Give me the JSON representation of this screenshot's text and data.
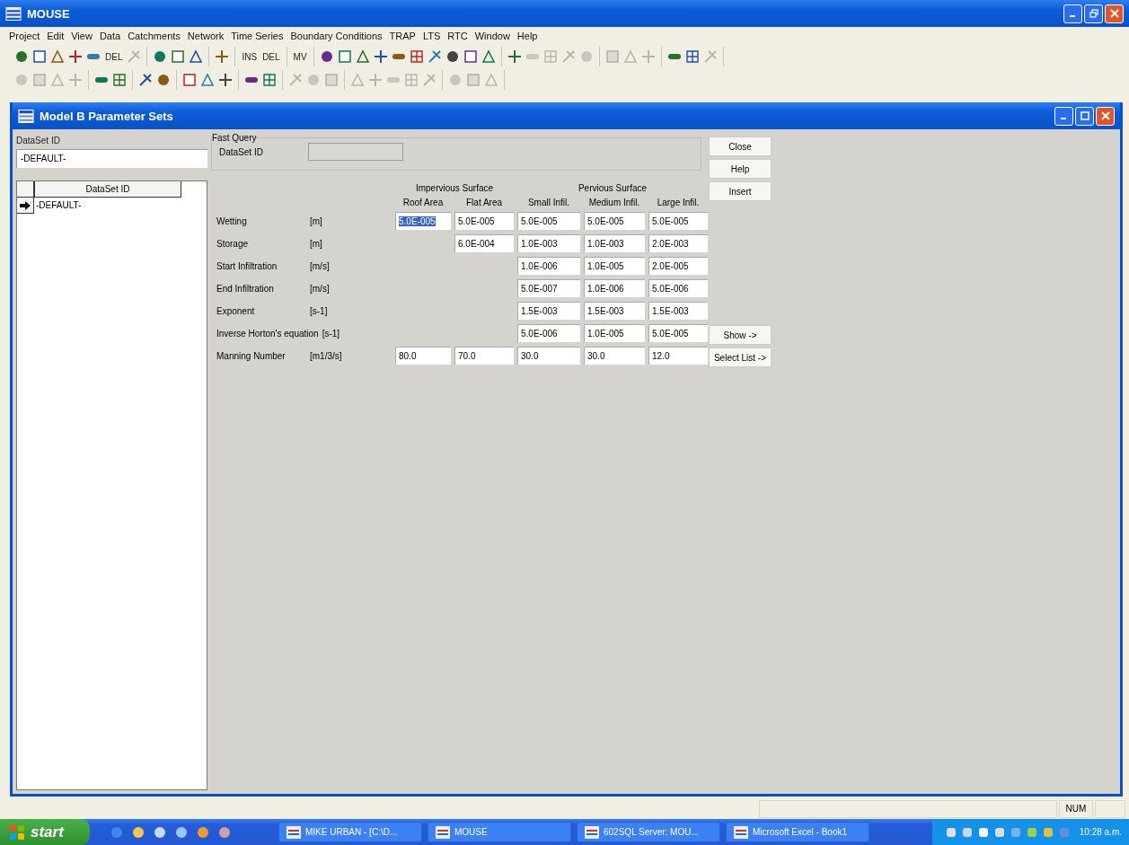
{
  "window": {
    "title": "MOUSE"
  },
  "menu": [
    "Project",
    "Edit",
    "View",
    "Data",
    "Catchments",
    "Network",
    "Time Series",
    "Boundary Conditions",
    "TRAP",
    "LTS",
    "RTC",
    "Window",
    "Help"
  ],
  "toolbars": [
    {
      "groups": [
        [
          {
            "kind": "icon",
            "disabled": false
          },
          {
            "kind": "icon",
            "disabled": false
          },
          {
            "kind": "icon",
            "disabled": false
          },
          {
            "kind": "icon",
            "disabled": false
          },
          {
            "kind": "icon",
            "disabled": false
          },
          {
            "kind": "text",
            "label": "DEL",
            "disabled": false
          },
          {
            "kind": "icon",
            "disabled": true
          }
        ],
        [
          {
            "kind": "icon",
            "disabled": false
          },
          {
            "kind": "icon",
            "disabled": false
          },
          {
            "kind": "icon",
            "disabled": false
          }
        ],
        [
          {
            "kind": "icon",
            "disabled": false
          }
        ],
        [
          {
            "kind": "text",
            "label": "INS",
            "disabled": false
          },
          {
            "kind": "text",
            "label": "DEL",
            "disabled": false
          }
        ],
        [
          {
            "kind": "text",
            "label": "MV",
            "disabled": false
          }
        ],
        [
          {
            "kind": "icon",
            "disabled": false
          },
          {
            "kind": "icon",
            "disabled": false
          },
          {
            "kind": "icon",
            "disabled": false
          },
          {
            "kind": "icon",
            "disabled": false
          },
          {
            "kind": "icon",
            "disabled": false
          },
          {
            "kind": "icon",
            "disabled": false
          },
          {
            "kind": "icon",
            "disabled": false
          },
          {
            "kind": "icon",
            "disabled": false
          },
          {
            "kind": "icon",
            "disabled": false
          },
          {
            "kind": "icon",
            "disabled": false
          }
        ],
        [
          {
            "kind": "icon",
            "disabled": false
          },
          {
            "kind": "icon",
            "disabled": true
          },
          {
            "kind": "icon",
            "disabled": true
          },
          {
            "kind": "icon",
            "disabled": true
          },
          {
            "kind": "icon",
            "disabled": true
          }
        ],
        [
          {
            "kind": "icon",
            "disabled": true
          },
          {
            "kind": "icon",
            "disabled": true
          },
          {
            "kind": "icon",
            "disabled": true
          }
        ],
        [
          {
            "kind": "icon",
            "disabled": false
          },
          {
            "kind": "icon",
            "disabled": false
          },
          {
            "kind": "icon",
            "disabled": true
          }
        ]
      ]
    },
    {
      "groups": [
        [
          {
            "kind": "icon",
            "disabled": true
          },
          {
            "kind": "icon",
            "disabled": true
          },
          {
            "kind": "icon",
            "disabled": true
          },
          {
            "kind": "icon",
            "disabled": true
          }
        ],
        [
          {
            "kind": "icon",
            "disabled": false
          },
          {
            "kind": "icon",
            "disabled": false
          }
        ],
        [
          {
            "kind": "icon",
            "disabled": false
          },
          {
            "kind": "icon",
            "disabled": false
          }
        ],
        [
          {
            "kind": "icon",
            "disabled": false
          },
          {
            "kind": "icon",
            "disabled": false
          },
          {
            "kind": "icon",
            "disabled": false
          }
        ],
        [
          {
            "kind": "icon",
            "disabled": false
          },
          {
            "kind": "icon",
            "disabled": false
          }
        ],
        [
          {
            "kind": "icon",
            "disabled": true
          },
          {
            "kind": "icon",
            "disabled": true
          },
          {
            "kind": "icon",
            "disabled": true
          }
        ],
        [
          {
            "kind": "icon",
            "disabled": true
          },
          {
            "kind": "icon",
            "disabled": true
          },
          {
            "kind": "icon",
            "disabled": true
          },
          {
            "kind": "icon",
            "disabled": true
          },
          {
            "kind": "icon",
            "disabled": true
          }
        ],
        [
          {
            "kind": "icon",
            "disabled": true
          },
          {
            "kind": "icon",
            "disabled": true
          },
          {
            "kind": "icon",
            "disabled": true
          }
        ]
      ]
    }
  ],
  "child_window": {
    "title": "Model B Parameter Sets",
    "dataset_label": "DataSet ID",
    "dataset_value": "-DEFAULT-",
    "dataset_grid": {
      "header": "DataSet ID",
      "rows": [
        {
          "value": "-DEFAULT-",
          "current": true
        }
      ]
    },
    "fast_query": {
      "title": "Fast Query",
      "label": "DataSet ID"
    },
    "buttons": [
      "Close",
      "Help",
      "Insert"
    ],
    "list_buttons": [
      "Show ->",
      "Select List ->"
    ],
    "parameters": {
      "groups": [
        {
          "label": "Impervious Surface"
        },
        {
          "label": "Pervious Surface"
        }
      ],
      "columns": [
        "Roof Area",
        "Flat Area",
        "Small Infil.",
        "Medium Infil.",
        "Large Infil."
      ],
      "rows": [
        {
          "label": "Wetting",
          "unit": "[m]",
          "cells": [
            {
              "value": "5.0E-005",
              "selected": true
            },
            {
              "value": "5.0E-005",
              "selected": false
            },
            {
              "value": "5.0E-005",
              "selected": false
            },
            {
              "value": "5.0E-005",
              "selected": false
            },
            {
              "value": "5.0E-005",
              "selected": false
            }
          ]
        },
        {
          "label": "Storage",
          "unit": "[m]",
          "cells": [
            null,
            {
              "value": "6.0E-004",
              "selected": false
            },
            {
              "value": "1.0E-003",
              "selected": false
            },
            {
              "value": "1.0E-003",
              "selected": false
            },
            {
              "value": "2.0E-003",
              "selected": false
            }
          ]
        },
        {
          "label": "Start Infiltration",
          "unit": "[m/s]",
          "cells": [
            null,
            null,
            {
              "value": "1.0E-006",
              "selected": false
            },
            {
              "value": "1.0E-005",
              "selected": false
            },
            {
              "value": "2.0E-005",
              "selected": false
            }
          ]
        },
        {
          "label": "End Infiltration",
          "unit": "[m/s]",
          "cells": [
            null,
            null,
            {
              "value": "5.0E-007",
              "selected": false
            },
            {
              "value": "1.0E-006",
              "selected": false
            },
            {
              "value": "5.0E-006",
              "selected": false
            }
          ]
        },
        {
          "label": "Exponent",
          "unit": "[s-1]",
          "cells": [
            null,
            null,
            {
              "value": "1.5E-003",
              "selected": false
            },
            {
              "value": "1.5E-003",
              "selected": false
            },
            {
              "value": "1.5E-003",
              "selected": false
            }
          ]
        },
        {
          "label": "Inverse Horton's equation",
          "unit": "[s-1]",
          "cells": [
            null,
            null,
            {
              "value": "5.0E-006",
              "selected": false
            },
            {
              "value": "1.0E-005",
              "selected": false
            },
            {
              "value": "5.0E-005",
              "selected": false
            }
          ]
        },
        {
          "label": "Manning Number",
          "unit": "[m1/3/s]",
          "cells": [
            {
              "value": "80.0",
              "selected": false
            },
            {
              "value": "70.0",
              "selected": false
            },
            {
              "value": "30.0",
              "selected": false
            },
            {
              "value": "30.0",
              "selected": false
            },
            {
              "value": "12.0",
              "selected": false
            }
          ]
        }
      ]
    }
  },
  "status_bar": {
    "indicator": "NUM"
  },
  "taskbar": {
    "start": "start",
    "tasks": [
      {
        "label": "MIKE URBAN - [C:\\D...",
        "active": false
      },
      {
        "label": "MOUSE",
        "active": false
      },
      {
        "label": "602SQL Server: MOU...",
        "active": false
      },
      {
        "label": "Microsoft Excel - Book1",
        "active": false
      }
    ],
    "clock": "10:28 a.m."
  }
}
